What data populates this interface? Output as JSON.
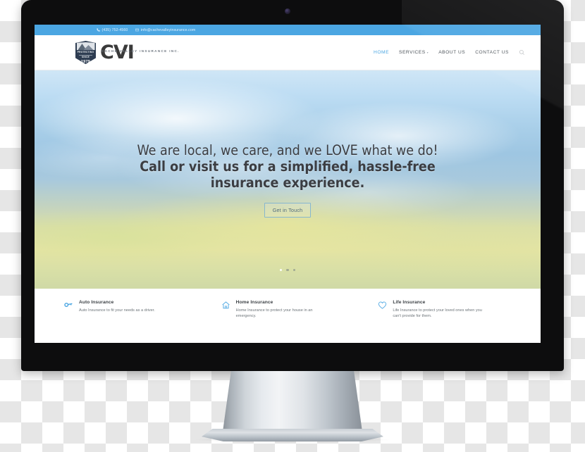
{
  "device": {
    "type": "desktop-monitor",
    "webcam": "webcam-dot",
    "frame_color": "#0d0d0e",
    "stand_color": "#d0d6db"
  },
  "site": {
    "topbar": {
      "phone": "(435) 752-4560",
      "phone_icon": "phone-icon",
      "email": "info@cachevalleyinsurance.com",
      "email_icon": "envelope-icon",
      "bg_color": "#4ba6e2"
    },
    "logo": {
      "badge_line1": "PROTECTING",
      "badge_line2": "SINCE",
      "badge_year": "1979",
      "mark": "CVI",
      "tagline": "CACHE VALLEY INSURANCE INC."
    },
    "nav": {
      "items": [
        {
          "label": "HOME",
          "active": true,
          "caret": ""
        },
        {
          "label": "SERVICES",
          "active": false,
          "caret": "▾"
        },
        {
          "label": "ABOUT US",
          "active": false,
          "caret": ""
        },
        {
          "label": "CONTACT US",
          "active": false,
          "caret": ""
        }
      ],
      "search_icon": "search-icon",
      "active_color": "#4ba6e2"
    },
    "hero": {
      "headline_light": "We are local, we care, and we LOVE what we do! ",
      "headline_bold": "Call or visit us for a simplified, hassle-free insurance experience.",
      "cta_label": "Get in Touch",
      "slider_dots": 3,
      "slider_active_index": 0,
      "background": "blurred mountain valley landscape"
    },
    "services": [
      {
        "icon": "key-icon",
        "title": "Auto Insurance",
        "description": "Auto Insurance to fit your needs as a driver."
      },
      {
        "icon": "house-icon",
        "title": "Home Insurance",
        "description": "Home Insurance to protect your house in an emergency."
      },
      {
        "icon": "heart-icon",
        "title": "Life Insurance",
        "description": "Life Insurance to protect your loved ones when you can't provide for them."
      }
    ]
  }
}
